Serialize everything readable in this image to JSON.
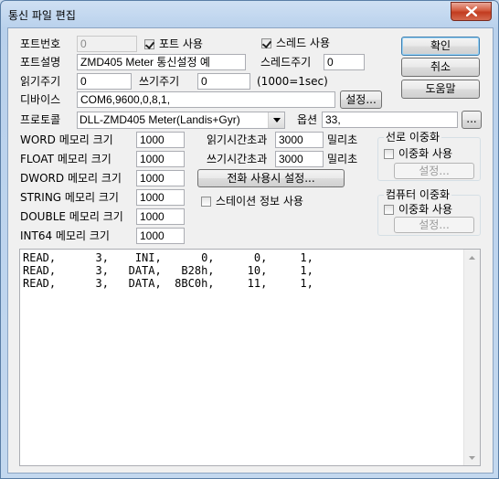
{
  "window": {
    "title": "통신 파일 편집"
  },
  "port": {
    "number_label": "포트번호",
    "number_value": "0",
    "use_port_label": "포트 사용",
    "use_port_checked": true,
    "use_thread_label": "스레드 사용",
    "use_thread_checked": true,
    "desc_label": "포트설명",
    "desc_value": "ZMD405 Meter 통신설정 예",
    "thread_period_label": "스레드주기",
    "thread_period_value": "0",
    "read_period_label": "읽기주기",
    "read_period_value": "0",
    "write_period_label": "쓰기주기",
    "write_period_value": "0",
    "period_hint": "(1000=1sec)",
    "device_label": "디바이스",
    "device_value": "COM6,9600,0,8,1,",
    "device_setup_button": "설정...",
    "protocol_label": "프로토콜",
    "protocol_value": "DLL-ZMD405 Meter(Landis+Gyr)",
    "option_label": "옵션",
    "option_value": "33,",
    "option_button": "..."
  },
  "memory": [
    {
      "label": "WORD 메모리 크기",
      "value": "1000"
    },
    {
      "label": "FLOAT 메모리 크기",
      "value": "1000"
    },
    {
      "label": "DWORD 메모리 크기",
      "value": "1000"
    },
    {
      "label": "STRING 메모리 크기",
      "value": "1000"
    },
    {
      "label": "DOUBLE 메모리 크기",
      "value": "1000"
    },
    {
      "label": "INT64 메모리 크기",
      "value": "1000"
    }
  ],
  "timeouts": {
    "read_label": "읽기시간초과",
    "read_value": "3000",
    "read_unit": "밀리초",
    "write_label": "쓰기시간초과",
    "write_value": "3000",
    "write_unit": "밀리초",
    "phone_button": "전화 사용시 설정...",
    "station_info_label": "스테이션 정보 사용",
    "station_info_checked": false
  },
  "buttons": {
    "ok": "확인",
    "cancel": "취소",
    "help": "도움말"
  },
  "line_redundancy": {
    "title": "선로 이중화",
    "use_label": "이중화 사용",
    "use_checked": false,
    "setup_button": "설정..."
  },
  "pc_redundancy": {
    "title": "컴퓨터 이중화",
    "use_label": "이중화 사용",
    "use_checked": false,
    "setup_button": "설정..."
  },
  "script_lines": [
    "READ,      3,    INI,      0,      0,     1,",
    "READ,      3,   DATA,   B28h,     10,     1,",
    "READ,      3,   DATA,  8BC0h,     11,     1,"
  ]
}
